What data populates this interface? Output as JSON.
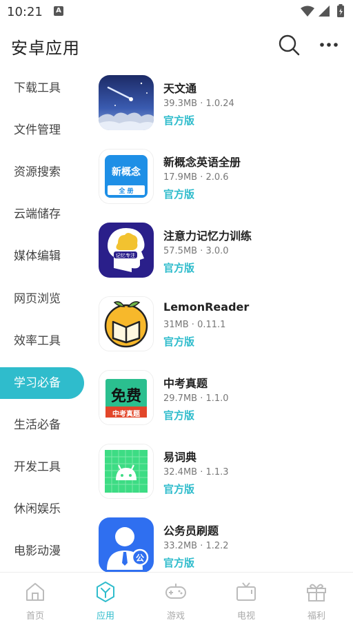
{
  "status": {
    "time": "10:21"
  },
  "header": {
    "title": "安卓应用"
  },
  "categories": [
    {
      "label": "下载工具"
    },
    {
      "label": "文件管理"
    },
    {
      "label": "资源搜索"
    },
    {
      "label": "云端储存"
    },
    {
      "label": "媒体编辑"
    },
    {
      "label": "网页浏览"
    },
    {
      "label": "效率工具"
    },
    {
      "label": "学习必备"
    },
    {
      "label": "生活必备"
    },
    {
      "label": "开发工具"
    },
    {
      "label": "休闲娱乐"
    },
    {
      "label": "电影动漫"
    }
  ],
  "selected_category": "学习必备",
  "apps": [
    {
      "name": "天文通",
      "meta": "39.3MB · 1.0.24",
      "badge": "官方版",
      "icon": "night-sky-icon"
    },
    {
      "name": "新概念英语全册",
      "meta": "17.9MB · 2.0.6",
      "badge": "官方版",
      "icon": "xingainian-book-icon",
      "icon_text": "新概念",
      "icon_sub": "全 册"
    },
    {
      "name": "注意力记忆力训练",
      "meta": "57.5MB · 3.0.0",
      "badge": "官方版",
      "icon": "brain-head-icon",
      "icon_text": "记忆专注"
    },
    {
      "name": "LemonReader",
      "meta": "31MB · 0.11.1",
      "badge": "官方版",
      "icon": "lemon-book-icon"
    },
    {
      "name": "中考真题",
      "meta": "29.7MB · 1.1.0",
      "badge": "官方版",
      "icon": "free-exam-icon",
      "icon_text": "免费",
      "icon_sub": "中考真题"
    },
    {
      "name": "易词典",
      "meta": "32.4MB · 1.1.3",
      "badge": "官方版",
      "icon": "android-grid-icon"
    },
    {
      "name": "公务员刷题",
      "meta": "33.2MB · 1.2.2",
      "badge": "官方版",
      "icon": "civil-servant-icon",
      "icon_text": "公"
    }
  ],
  "bottom_nav": [
    {
      "label": "首页",
      "icon": "home-icon"
    },
    {
      "label": "应用",
      "icon": "apps-hexagon-icon"
    },
    {
      "label": "游戏",
      "icon": "gamepad-icon"
    },
    {
      "label": "电视",
      "icon": "tv-icon"
    },
    {
      "label": "福利",
      "icon": "gift-icon"
    }
  ],
  "colors": {
    "accent": "#2fbccc",
    "text": "#222222",
    "muted": "#777777",
    "inactive": "#aaaaaa"
  }
}
